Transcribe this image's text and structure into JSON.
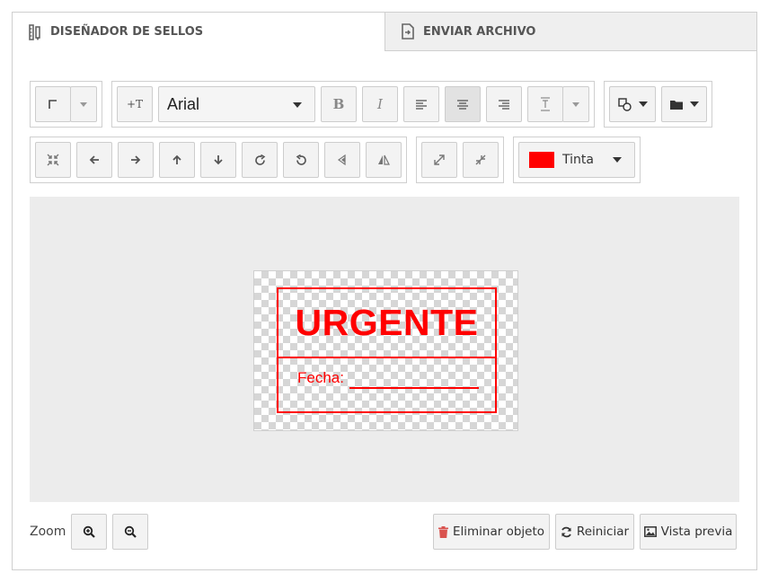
{
  "tabs": [
    {
      "label": "DISEÑADOR DE SELLOS",
      "icon": "ruler-pencil-icon"
    },
    {
      "label": "ENVIAR ARCHIVO",
      "icon": "file-import-icon"
    }
  ],
  "toolbar": {
    "add_text_label": "+T",
    "font": {
      "selected": "Arial"
    },
    "bold_label": "B",
    "italic_label": "I",
    "color": {
      "label": "Tinta",
      "swatch": "#ff0000"
    }
  },
  "stamp": {
    "title": "URGENTE",
    "date_label": "Fecha:",
    "ink_color": "#ff0000"
  },
  "footer": {
    "zoom_label": "Zoom",
    "delete_label": "Eliminar objeto",
    "reset_label": "Reiniciar",
    "preview_label": "Vista previa"
  },
  "colors": {
    "delete_icon": "#d9534f",
    "canvas_bg": "#ececec"
  }
}
